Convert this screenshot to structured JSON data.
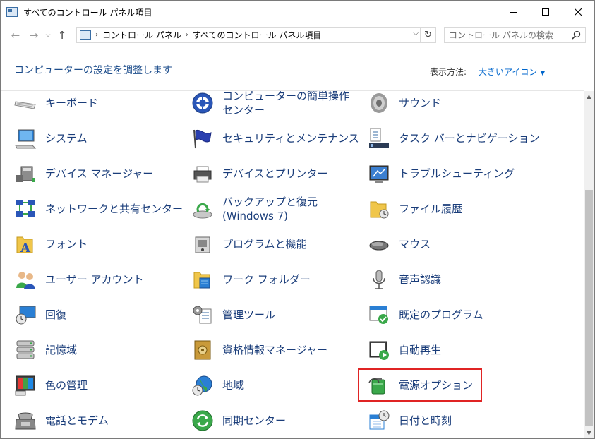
{
  "window": {
    "title": "すべてのコントロール パネル項目"
  },
  "address": {
    "crumbs": [
      "コントロール パネル",
      "すべてのコントロール パネル項目"
    ]
  },
  "search": {
    "placeholder": "コントロール パネルの検索"
  },
  "header": {
    "title": "コンピューターの設定を調整します",
    "view_label": "表示方法:",
    "view_value": "大きいアイコン"
  },
  "items": {
    "keyboard": "キーボード",
    "ease": "コンピューターの簡単操作センター",
    "sound": "サウンド",
    "system": "システム",
    "security": "セキュリティとメンテナンス",
    "taskbar": "タスク バーとナビゲーション",
    "device_manager": "デバイス マネージャー",
    "devices_printers": "デバイスとプリンター",
    "troubleshooting": "トラブルシューティング",
    "network": "ネットワークと共有センター",
    "backup": "バックアップと復元 (Windows 7)",
    "file_history": "ファイル履歴",
    "fonts": "フォント",
    "programs": "プログラムと機能",
    "mouse": "マウス",
    "user_accounts": "ユーザー アカウント",
    "work_folders": "ワーク フォルダー",
    "speech": "音声認識",
    "recovery": "回復",
    "admin_tools": "管理ツール",
    "default_programs": "既定のプログラム",
    "storage": "記憶域",
    "credential": "資格情報マネージャー",
    "autoplay": "自動再生",
    "color": "色の管理",
    "region": "地域",
    "power": "電源オプション",
    "phone_modem": "電話とモデム",
    "sync": "同期センター",
    "datetime": "日付と時刻"
  }
}
